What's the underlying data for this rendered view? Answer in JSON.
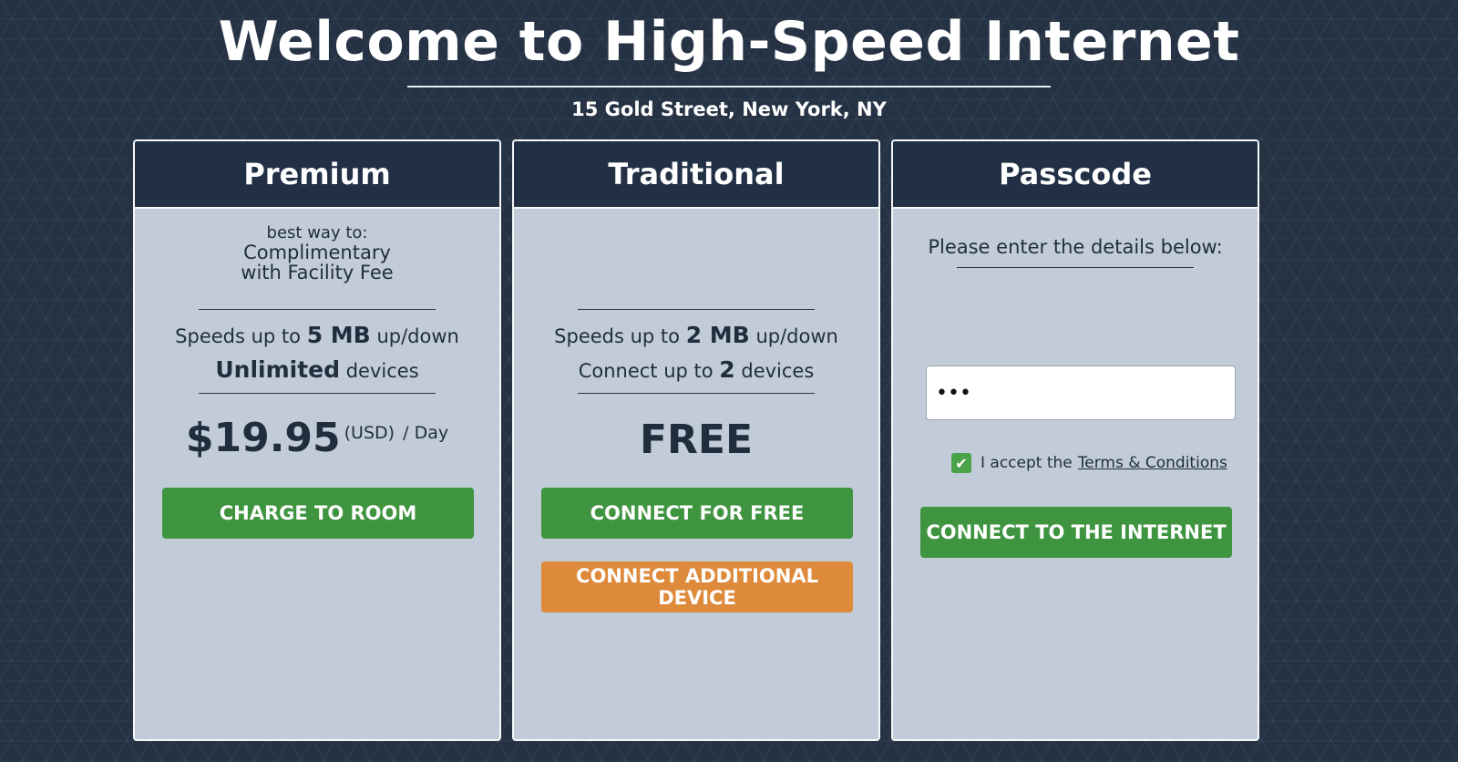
{
  "header": {
    "title": "Welcome to High-Speed Internet",
    "address": "15 Gold Street, New York, NY"
  },
  "premium": {
    "title": "Premium",
    "tagline_1": "best way to:",
    "tagline_2": "Complimentary",
    "tagline_3": "with Facility Fee",
    "speed_prefix": "Speeds up to",
    "speed_value": "5 MB",
    "speed_suffix": "up/down",
    "devices_value": "Unlimited",
    "devices_suffix": "devices",
    "price": "$19.95",
    "price_currency": "(USD)",
    "price_period": "/ Day",
    "button": "CHARGE TO ROOM"
  },
  "traditional": {
    "title": "Traditional",
    "speed_prefix": "Speeds up to",
    "speed_value": "2 MB",
    "speed_suffix": "up/down",
    "devices_prefix": "Connect up to",
    "devices_value": "2",
    "devices_suffix": "devices",
    "price": "FREE",
    "button_primary": "CONNECT FOR FREE",
    "button_secondary": "CONNECT ADDITIONAL DEVICE"
  },
  "passcode": {
    "title": "Passcode",
    "instruction": "Please enter the details below:",
    "input_value": "•••",
    "terms_prefix": "I accept the",
    "terms_link": "Terms & Conditions",
    "terms_checked": true,
    "button": "CONNECT TO THE INTERNET"
  },
  "colors": {
    "background": "#243244",
    "card_header": "#213044",
    "card_body": "#c2ccd8",
    "green_button": "#3f9440",
    "orange_button": "#de8a3b"
  }
}
